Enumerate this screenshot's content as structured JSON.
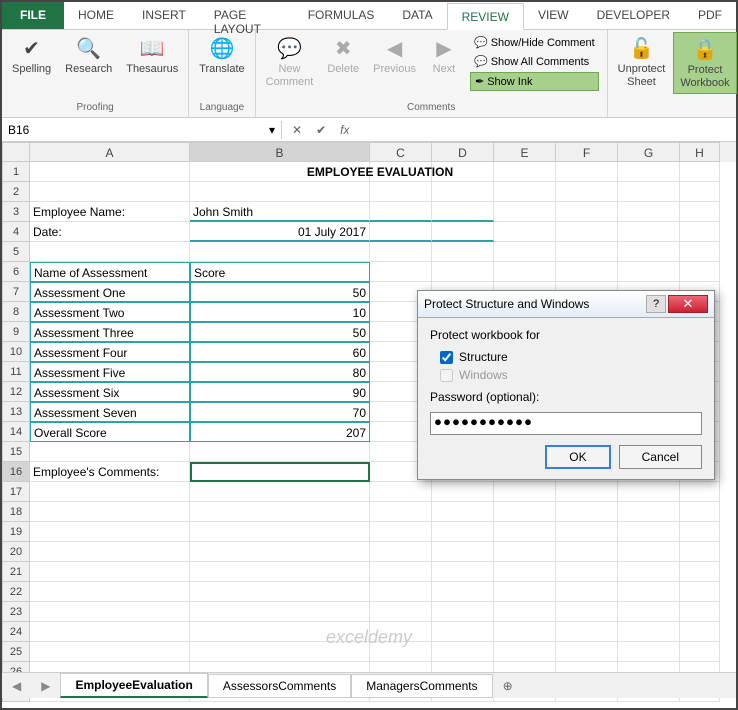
{
  "ribbon": {
    "tabs": [
      "FILE",
      "HOME",
      "INSERT",
      "PAGE LAYOUT",
      "FORMULAS",
      "DATA",
      "REVIEW",
      "VIEW",
      "DEVELOPER",
      "PDF"
    ],
    "active_tab": "REVIEW",
    "groups": {
      "proofing": {
        "label": "Proofing",
        "items": [
          "Spelling",
          "Research",
          "Thesaurus"
        ]
      },
      "language": {
        "label": "Language",
        "items": [
          "Translate"
        ]
      },
      "comments": {
        "label": "Comments",
        "items": [
          "New\nComment",
          "Delete",
          "Previous",
          "Next"
        ],
        "small": [
          "Show/Hide Comment",
          "Show All Comments",
          "Show Ink"
        ]
      },
      "changes": {
        "items": [
          "Unprotect\nSheet",
          "Protect\nWorkbook"
        ]
      }
    }
  },
  "namebox": "B16",
  "fx": "fx",
  "columns": [
    "A",
    "B",
    "C",
    "D",
    "E",
    "F",
    "G",
    "H"
  ],
  "sheet": {
    "title": "EMPLOYEE EVALUATION",
    "emp_name_label": "Employee Name:",
    "emp_name": "John Smith",
    "date_label": "Date:",
    "date_value": "01 July 2017",
    "hdr_name": "Name of Assessment",
    "hdr_score": "Score",
    "rows": [
      {
        "name": "Assessment One",
        "score": 50
      },
      {
        "name": "Assessment Two",
        "score": 10
      },
      {
        "name": "Assessment Three",
        "score": 50
      },
      {
        "name": "Assessment Four",
        "score": 60
      },
      {
        "name": "Assessment Five",
        "score": 80
      },
      {
        "name": "Assessment Six",
        "score": 90
      },
      {
        "name": "Assessment Seven",
        "score": 70
      }
    ],
    "overall_label": "Overall Score",
    "overall_score": 207,
    "comments_label": "Employee's Comments:"
  },
  "tabs": [
    "EmployeeEvaluation",
    "AssessorsComments",
    "ManagersComments"
  ],
  "watermark": "exceldemy",
  "dialog": {
    "title": "Protect Structure and Windows",
    "section": "Protect workbook for",
    "opt_structure": "Structure",
    "opt_windows": "Windows",
    "pwd_label": "Password (optional):",
    "pwd_value": "●●●●●●●●●●●",
    "ok": "OK",
    "cancel": "Cancel"
  }
}
